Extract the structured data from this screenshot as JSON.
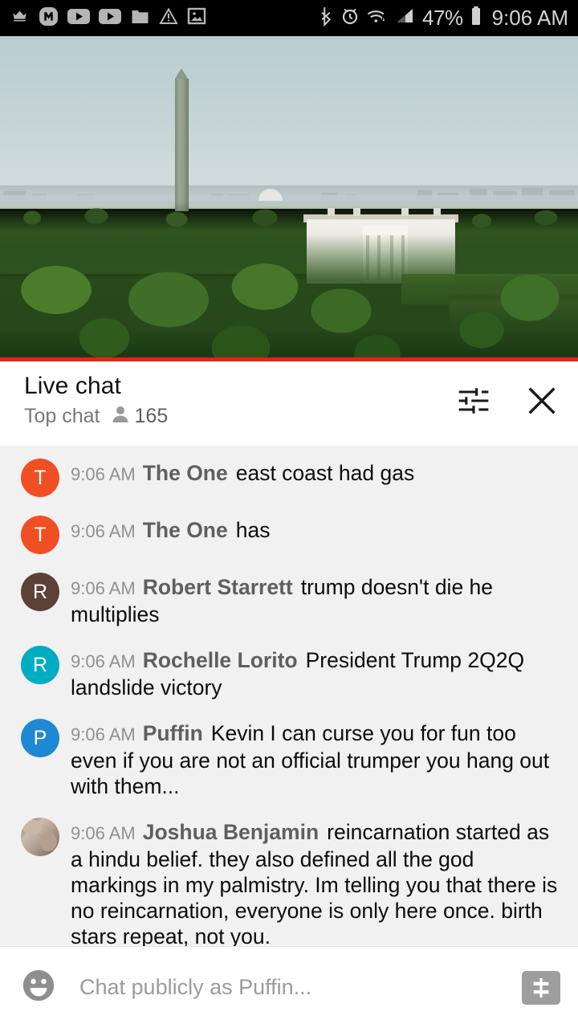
{
  "status_bar": {
    "left_icons": [
      "crown-icon",
      "m-app-icon",
      "youtube-icon",
      "youtube-alt-icon",
      "folder-icon",
      "warning-triangle-icon",
      "image-icon"
    ],
    "right_icons": [
      "bluetooth-icon",
      "alarm-clock-icon",
      "wifi-icon",
      "cellular-signal-icon",
      "battery-icon"
    ],
    "battery_percent": "47%",
    "clock": "9:06 AM"
  },
  "video": {
    "name": "white-house-live-stream",
    "progress_color": "#e62117",
    "progress_percent": 100
  },
  "chat_header": {
    "title": "Live chat",
    "subtitle": "Top chat",
    "viewer_count": "165",
    "viewer_icon": "person-icon",
    "settings_icon": "tune-sliders-icon",
    "close_icon": "close-x-icon"
  },
  "messages": [
    {
      "time": "9:06 AM",
      "author": "The One",
      "text": "east coast had gas",
      "avatar_letter": "T",
      "avatar_color": "#f04e23",
      "avatar_type": "letter"
    },
    {
      "time": "9:06 AM",
      "author": "The One",
      "text": "has",
      "avatar_letter": "T",
      "avatar_color": "#f04e23",
      "avatar_type": "letter"
    },
    {
      "time": "9:06 AM",
      "author": "Robert Starrett",
      "text": "trump doesn't die he multiplies",
      "avatar_letter": "R",
      "avatar_color": "#5d4037",
      "avatar_type": "letter"
    },
    {
      "time": "9:06 AM",
      "author": "Rochelle Lorito",
      "text": "President Trump 2Q2Q landslide victory",
      "avatar_letter": "R",
      "avatar_color": "#00acc1",
      "avatar_type": "letter"
    },
    {
      "time": "9:06 AM",
      "author": "Puffin",
      "text": "Kevin I can curse you for fun too even if you are not an official trumper you hang out with them...",
      "avatar_letter": "P",
      "avatar_color": "#1e88d4",
      "avatar_type": "letter"
    },
    {
      "time": "9:06 AM",
      "author": "Joshua Benjamin",
      "text": "reincarnation started as a hindu belief. they also defined all the god markings in my palmistry. Im telling you that there is no reincarnation, everyone is only here once. birth stars repeat, not you.",
      "avatar_letter": "",
      "avatar_color": "#a8907c",
      "avatar_type": "photo"
    }
  ],
  "composer": {
    "emoji_icon": "emoji-smiley-icon",
    "placeholder": "Chat publicly as Puffin...",
    "value": "",
    "superchat_icon": "dollar-sign-icon"
  }
}
